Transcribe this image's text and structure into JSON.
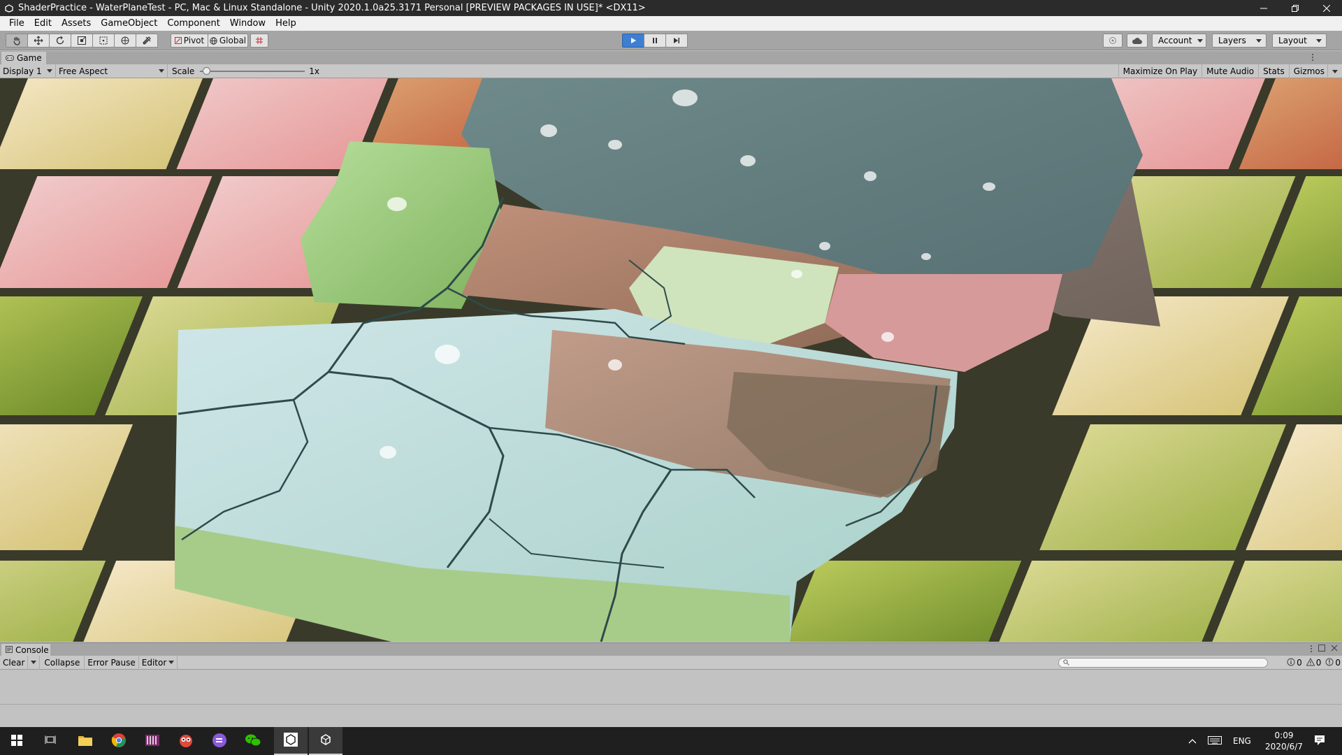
{
  "window": {
    "title": "ShaderPractice - WaterPlaneTest - PC, Mac & Linux Standalone - Unity 2020.1.0a25.3171 Personal [PREVIEW PACKAGES IN USE]* <DX11>"
  },
  "menu": [
    "File",
    "Edit",
    "Assets",
    "GameObject",
    "Component",
    "Window",
    "Help"
  ],
  "toolbar": {
    "pivot_label": "Pivot",
    "global_label": "Global",
    "account_label": "Account",
    "layers_label": "Layers",
    "layout_label": "Layout"
  },
  "game_panel": {
    "tab_label": "Game",
    "display_label": "Display 1",
    "aspect_label": "Free Aspect",
    "scale_label": "Scale",
    "scale_value": "1x",
    "maximize_label": "Maximize On Play",
    "mute_label": "Mute Audio",
    "stats_label": "Stats",
    "gizmos_label": "Gizmos"
  },
  "console_panel": {
    "tab_label": "Console",
    "clear_label": "Clear",
    "collapse_label": "Collapse",
    "error_pause_label": "Error Pause",
    "editor_label": "Editor",
    "info_count": "0",
    "warning_count": "0",
    "error_count": "0"
  },
  "taskbar": {
    "language": "ENG",
    "time": "0:09",
    "date": "2020/6/7"
  },
  "colors": {
    "play_active": "#3f7fd2",
    "title_bg": "#2b2b2b",
    "taskbar_bg": "#1f1f1f"
  }
}
